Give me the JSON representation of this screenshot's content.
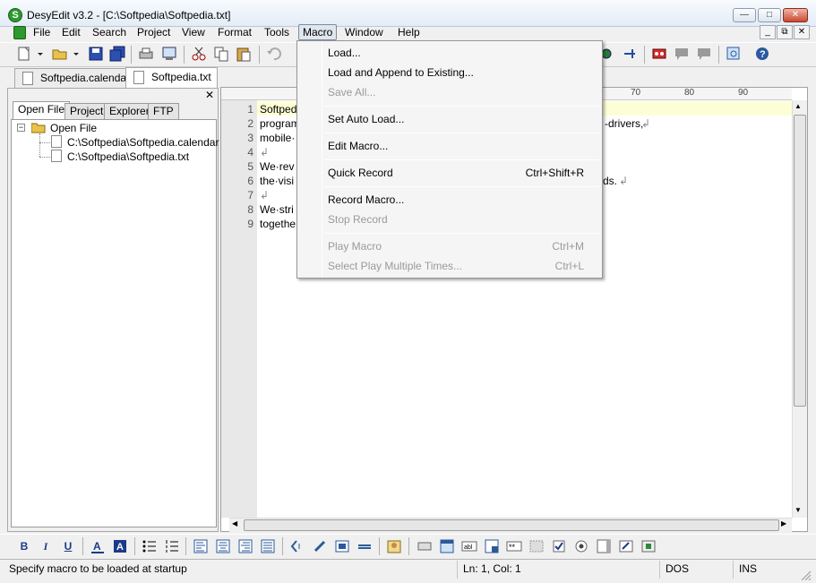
{
  "window": {
    "title": "DesyEdit v3.2 - [C:\\Softpedia\\Softpedia.txt]"
  },
  "menubar": {
    "items": [
      "File",
      "Edit",
      "Search",
      "Project",
      "View",
      "Format",
      "Tools",
      "Macro",
      "Window",
      "Help"
    ],
    "active": "Macro"
  },
  "tabs": {
    "documents": [
      "Softpedia.calendar",
      "Softpedia.txt"
    ],
    "active": "Softpedia.txt"
  },
  "left_pane": {
    "tabs": [
      "Open File",
      "Project",
      "Explorer",
      "FTP"
    ],
    "tree": {
      "root": "Open File",
      "files": [
        "C:\\Softpedia\\Softpedia.calendar",
        "C:\\Softpedia\\Softpedia.txt"
      ]
    }
  },
  "editor": {
    "ruler": [
      "70",
      "80",
      "90"
    ],
    "line_numbers": [
      "1",
      "2",
      "3",
      "4",
      "5",
      "6",
      "7",
      "8",
      "9"
    ],
    "lines": [
      {
        "left": "Softpedi",
        "right": ""
      },
      {
        "left": "program",
        "right": "-drivers,"
      },
      {
        "left": "mobile·",
        "right": ""
      },
      {
        "left": "",
        "right": ""
      },
      {
        "left": "We·rev",
        "right": ""
      },
      {
        "left": "the·visi",
        "right": "ds."
      },
      {
        "left": "",
        "right": ""
      },
      {
        "left": "We·stri",
        "right": ""
      },
      {
        "left": "togethe",
        "right": ""
      }
    ],
    "eol_mark": "↲"
  },
  "macro_menu": {
    "items": [
      {
        "label": "Load...",
        "shortcut": "",
        "enabled": true
      },
      {
        "label": "Load and Append to Existing...",
        "shortcut": "",
        "enabled": true
      },
      {
        "label": "Save All...",
        "shortcut": "",
        "enabled": false
      },
      {
        "label": "Set Auto Load...",
        "shortcut": "",
        "enabled": true
      },
      {
        "label": "Edit Macro...",
        "shortcut": "",
        "enabled": true
      },
      {
        "label": "Quick Record",
        "shortcut": "Ctrl+Shift+R",
        "enabled": true
      },
      {
        "label": "Record Macro...",
        "shortcut": "",
        "enabled": true
      },
      {
        "label": "Stop Record",
        "shortcut": "",
        "enabled": false
      },
      {
        "label": "Play Macro",
        "shortcut": "Ctrl+M",
        "enabled": false
      },
      {
        "label": "Select Play Multiple Times...",
        "shortcut": "Ctrl+L",
        "enabled": false
      }
    ]
  },
  "format_toolbar": {
    "bold": "B",
    "italic": "I",
    "underline": "U"
  },
  "statusbar": {
    "message": "Specify macro to be loaded at startup",
    "position": "Ln: 1, Col: 1",
    "line_ending": "DOS",
    "mode": "INS"
  },
  "colors": {
    "current_line": "#fefed6",
    "menu_bg": "#f5f5f5",
    "titlebar": "#e3ecf6"
  }
}
